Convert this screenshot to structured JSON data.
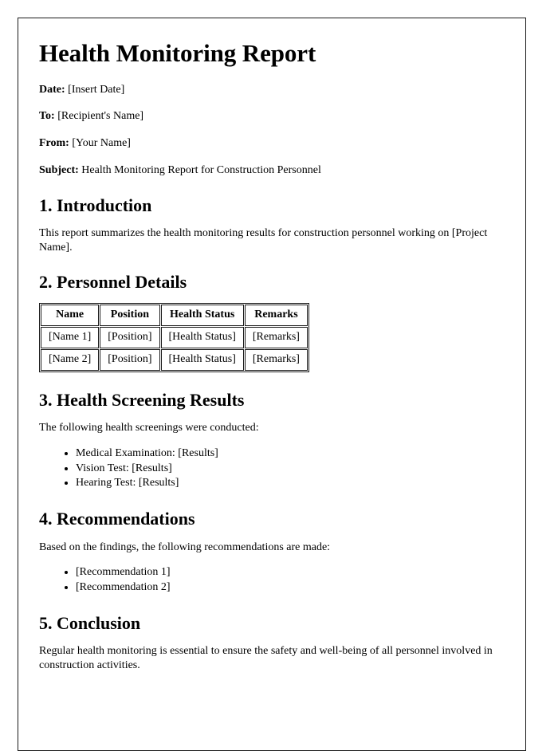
{
  "document": {
    "title": "Health Monitoring Report",
    "meta": [
      {
        "label": "Date:",
        "value": "[Insert Date]"
      },
      {
        "label": "To:",
        "value": "[Recipient's Name]"
      },
      {
        "label": "From:",
        "value": "[Your Name]"
      },
      {
        "label": "Subject:",
        "value": "Health Monitoring Report for Construction Personnel"
      }
    ],
    "sections": {
      "introduction": {
        "heading": "1. Introduction",
        "paragraph": "This report summarizes the health monitoring results for construction personnel working on [Project Name]."
      },
      "personnel": {
        "heading": "2. Personnel Details",
        "table": {
          "columns": [
            "Name",
            "Position",
            "Health Status",
            "Remarks"
          ],
          "rows": [
            [
              "[Name 1]",
              "[Position]",
              "[Health Status]",
              "[Remarks]"
            ],
            [
              "[Name 2]",
              "[Position]",
              "[Health Status]",
              "[Remarks]"
            ]
          ]
        }
      },
      "screening": {
        "heading": "3. Health Screening Results",
        "paragraph": "The following health screenings were conducted:",
        "items": [
          "Medical Examination: [Results]",
          "Vision Test: [Results]",
          "Hearing Test: [Results]"
        ]
      },
      "recommendations": {
        "heading": "4. Recommendations",
        "paragraph": "Based on the findings, the following recommendations are made:",
        "items": [
          "[Recommendation 1]",
          "[Recommendation 2]"
        ]
      },
      "conclusion": {
        "heading": "5. Conclusion",
        "paragraph": "Regular health monitoring is essential to ensure the safety and well-being of all personnel involved in construction activities."
      }
    }
  },
  "colors": {
    "page_border": "#1a1a1a",
    "text": "#000000",
    "page_background": "#ffffff"
  }
}
